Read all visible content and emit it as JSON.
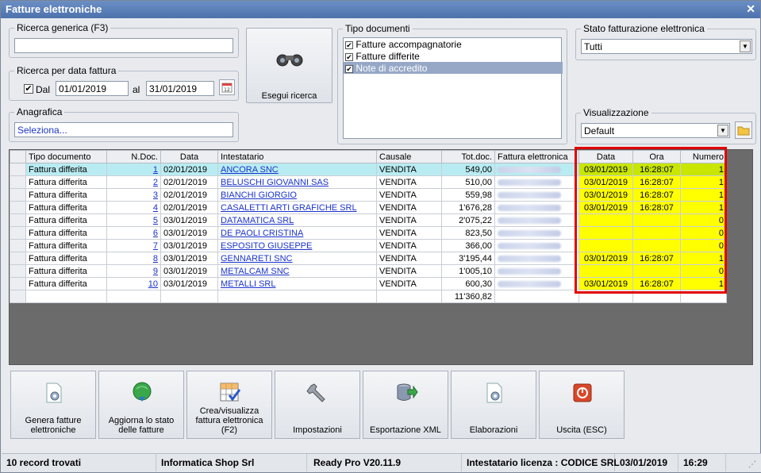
{
  "window": {
    "title": "Fatture elettroniche"
  },
  "search": {
    "generic_label": "Ricerca generica (F3)",
    "generic_value": "",
    "date_group_label": "Ricerca per data fattura",
    "dal_label": "Dal",
    "dal_checked": true,
    "date_from": "01/01/2019",
    "al_label": "al",
    "date_to": "31/01/2019",
    "anagrafica_label": "Anagrafica",
    "anagrafica_value": "Seleziona...",
    "search_button": "Esegui ricerca"
  },
  "tipo_documenti": {
    "label": "Tipo documenti",
    "items": [
      {
        "label": "Fatture accompagnatorie",
        "checked": true
      },
      {
        "label": "Fatture differite",
        "checked": true
      },
      {
        "label": "Note di accredito",
        "checked": true
      }
    ]
  },
  "stato": {
    "label": "Stato fatturazione elettronica",
    "value": "Tutti"
  },
  "visualizzazione": {
    "label": "Visualizzazione",
    "value": "Default"
  },
  "grid": {
    "columns": [
      "Tipo documento",
      "N.Doc.",
      "Data",
      "Intestatario",
      "Causale",
      "Tot.doc.",
      "Fattura elettronica",
      "Data",
      "Ora",
      "Numero"
    ],
    "rows": [
      [
        "Fattura differita",
        "1",
        "02/01/2019",
        "ANCORA SNC",
        "VENDITA",
        "549,00",
        "",
        "03/01/2019",
        "16:28:07",
        "1"
      ],
      [
        "Fattura differita",
        "2",
        "02/01/2019",
        "BELUSCHI GIOVANNI SAS",
        "VENDITA",
        "510,00",
        "",
        "03/01/2019",
        "16:28:07",
        "1"
      ],
      [
        "Fattura differita",
        "3",
        "02/01/2019",
        "BIANCHI GIORGIO",
        "VENDITA",
        "559,98",
        "",
        "03/01/2019",
        "16:28:07",
        "1"
      ],
      [
        "Fattura differita",
        "4",
        "02/01/2019",
        "CASALETTI ARTI GRAFICHE SRL",
        "VENDITA",
        "1'676,28",
        "",
        "03/01/2019",
        "16:28:07",
        "1"
      ],
      [
        "Fattura differita",
        "5",
        "03/01/2019",
        "DATAMATICA SRL",
        "VENDITA",
        "2'075,22",
        "",
        "",
        "",
        "0"
      ],
      [
        "Fattura differita",
        "6",
        "03/01/2019",
        "DE PAOLI CRISTINA",
        "VENDITA",
        "823,50",
        "",
        "",
        "",
        "0"
      ],
      [
        "Fattura differita",
        "7",
        "03/01/2019",
        "ESPOSITO GIUSEPPE",
        "VENDITA",
        "366,00",
        "",
        "",
        "",
        "0"
      ],
      [
        "Fattura differita",
        "8",
        "03/01/2019",
        "GENNARETI SNC",
        "VENDITA",
        "3'195,44",
        "",
        "03/01/2019",
        "16:28:07",
        "1"
      ],
      [
        "Fattura differita",
        "9",
        "03/01/2019",
        "METALCAM SNC",
        "VENDITA",
        "1'005,10",
        "",
        "",
        "",
        "0"
      ],
      [
        "Fattura differita",
        "10",
        "03/01/2019",
        "METALLI SRL",
        "VENDITA",
        "600,30",
        "",
        "03/01/2019",
        "16:28:07",
        "1"
      ]
    ],
    "total": "11'360,82"
  },
  "buttons": [
    {
      "label": "Genera fatture elettroniche",
      "icon": "doc-gear-icon"
    },
    {
      "label": "Aggiorna lo stato delle fatture",
      "icon": "globe-download-icon"
    },
    {
      "label": "Crea/visualizza fattura elettronica (F2)",
      "icon": "grid-check-icon"
    },
    {
      "label": "Impostazioni",
      "icon": "wrench-icon"
    },
    {
      "label": "Esportazione XML",
      "icon": "database-export-icon"
    },
    {
      "label": "Elaborazioni",
      "icon": "doc-gear-icon"
    },
    {
      "label": "Uscita (ESC)",
      "icon": "power-icon"
    }
  ],
  "status": {
    "records": "10 record trovati",
    "company": "Informatica Shop Srl",
    "version": "Ready Pro V20.11.9",
    "license": "Intestatario licenza : CODICE SRL",
    "date": "03/01/2019",
    "time": "16:29"
  },
  "colors": {
    "title_bar": "#5a7db6",
    "highlight_yellow": "#ffff00",
    "selected_row": "#b9ecf2",
    "red_frame": "#e10000"
  }
}
